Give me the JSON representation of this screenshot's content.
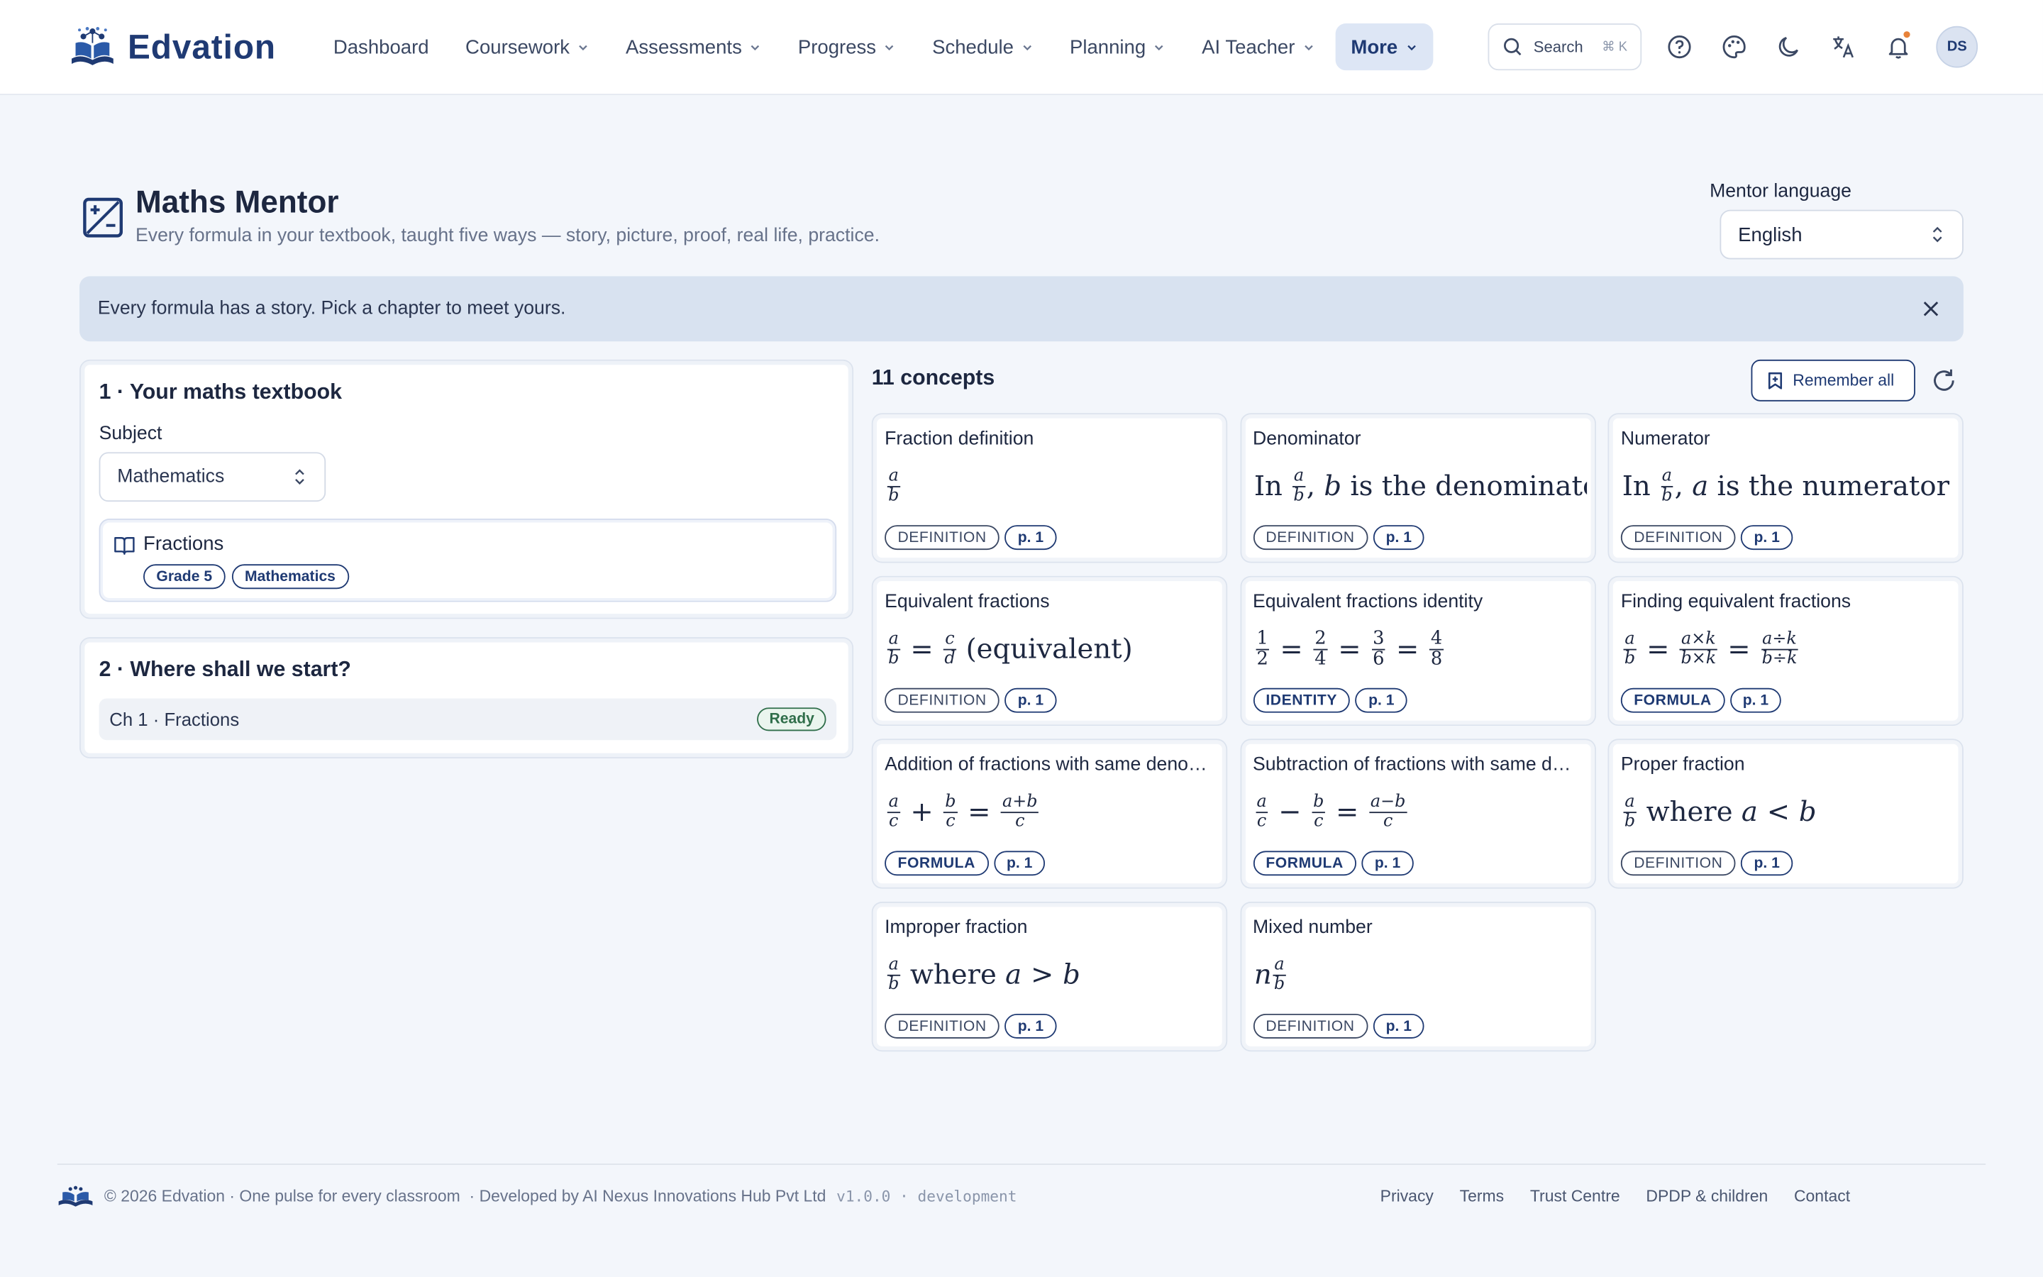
{
  "app": {
    "brand": "Edvation",
    "nav": [
      {
        "label": "Dashboard",
        "has_menu": false
      },
      {
        "label": "Coursework",
        "has_menu": true
      },
      {
        "label": "Assessments",
        "has_menu": true
      },
      {
        "label": "Progress",
        "has_menu": true
      },
      {
        "label": "Schedule",
        "has_menu": true
      },
      {
        "label": "Planning",
        "has_menu": true
      },
      {
        "label": "AI Teacher",
        "has_menu": true
      },
      {
        "label": "More",
        "has_menu": true,
        "active": true
      }
    ],
    "search": {
      "label": "Search",
      "shortcut": "⌘ K"
    },
    "avatar_initials": "DS",
    "accent_color": "#1f3a73",
    "notification_dot_color": "#e8833a"
  },
  "page": {
    "title": "Maths Mentor",
    "subtitle": "Every formula in your textbook, taught five ways — story, picture, proof, real life, practice.",
    "language_label": "Mentor language",
    "language_value": "English",
    "banner": "Every formula has a story. Pick a chapter to meet yours."
  },
  "textbook": {
    "title": "1 · Your maths textbook",
    "subject_label": "Subject",
    "subject_value": "Mathematics",
    "book_title": "Fractions",
    "book_tags": [
      "Grade 5",
      "Mathematics"
    ]
  },
  "start": {
    "title": "2 · Where shall we start?",
    "chapter": "Ch 1 · Fractions",
    "status": "Ready"
  },
  "concepts": {
    "count_label": "11 concepts",
    "remember_label": "Remember all",
    "items": [
      {
        "title": "Fraction definition",
        "kind": "DEFINITION",
        "page": "p. 1"
      },
      {
        "title": "Denominator",
        "kind": "DEFINITION",
        "page": "p. 1"
      },
      {
        "title": "Numerator",
        "kind": "DEFINITION",
        "page": "p. 1"
      },
      {
        "title": "Equivalent fractions",
        "kind": "DEFINITION",
        "page": "p. 1"
      },
      {
        "title": "Equivalent fractions identity",
        "kind": "IDENTITY",
        "page": "p. 1"
      },
      {
        "title": "Finding equivalent fractions",
        "kind": "FORMULA",
        "page": "p. 1"
      },
      {
        "title": "Addition of fractions with same denominator",
        "kind": "FORMULA",
        "page": "p. 1"
      },
      {
        "title": "Subtraction of fractions with same denominator",
        "kind": "FORMULA",
        "page": "p. 1"
      },
      {
        "title": "Proper fraction",
        "kind": "DEFINITION",
        "page": "p. 1"
      },
      {
        "title": "Improper fraction",
        "kind": "DEFINITION",
        "page": "p. 1"
      },
      {
        "title": "Mixed number",
        "kind": "DEFINITION",
        "page": "p. 1"
      }
    ],
    "formula_text": {
      "in": "In",
      "denom_tail": "is the denominator",
      "num_tail": "is the numerator",
      "equivalent": "(equivalent)",
      "where": "where"
    }
  },
  "footer": {
    "copyright": "© 2026 Edvation · One pulse for every classroom",
    "developer": "· Developed by AI Nexus Innovations Hub Pvt Ltd",
    "version": "v1.0.0 · development",
    "links": [
      "Privacy",
      "Terms",
      "Trust Centre",
      "DPDP & children",
      "Contact"
    ]
  }
}
